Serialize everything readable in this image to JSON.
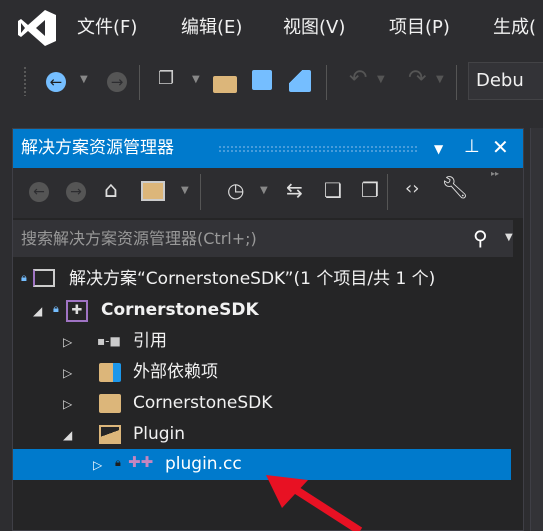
{
  "menu": {
    "items": [
      "文件(F)",
      "编辑(E)",
      "视图(V)",
      "项目(P)",
      "生成("
    ]
  },
  "toolbar": {
    "config": "Debu"
  },
  "solution_explorer": {
    "title": "解决方案资源管理器",
    "search_placeholder": "搜索解决方案资源管理器(Ctrl+;)",
    "tree": {
      "solution": "解决方案“CornerstoneSDK”(1 个项目/共 1 个)",
      "project": "CornerstoneSDK",
      "references": "引用",
      "external_deps": "外部依赖项",
      "filter_cornerstone": "CornerstoneSDK",
      "filter_plugin": "Plugin",
      "file": "plugin.cc"
    }
  },
  "colors": {
    "accent": "#007acc",
    "arrow": "#e81123"
  }
}
